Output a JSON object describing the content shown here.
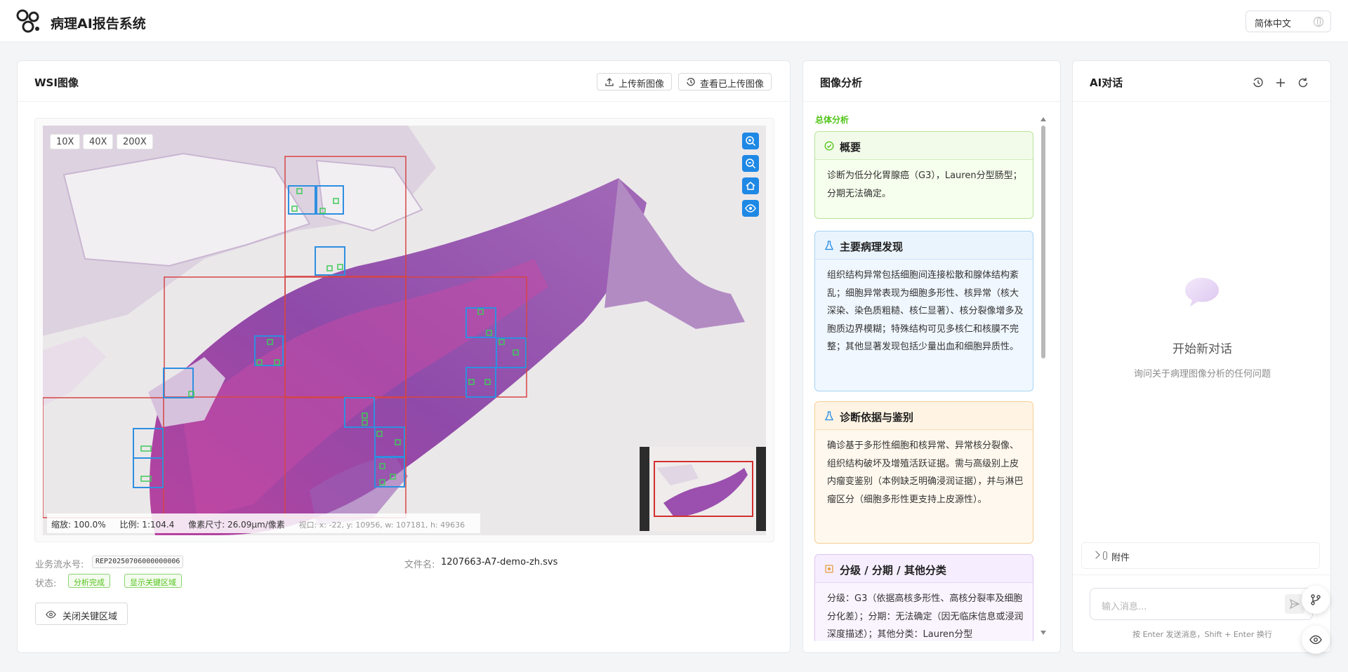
{
  "app": {
    "title": "病理AI报告系统",
    "language": "简体中文"
  },
  "wsi": {
    "title": "WSI图像",
    "upload_label": "上传新图像",
    "view_uploaded_label": "查看已上传图像",
    "zoom_levels": [
      "10X",
      "40X",
      "200X"
    ],
    "status": {
      "zoom": "缩放: 100.0%",
      "ratio": "比例: 1:104.4",
      "pixel_size": "像素尺寸: 26.09μm/像素",
      "viewport": "视口: x: -22, y: 10956, w: 107181, h: 49636"
    },
    "meta": {
      "serial_label": "业务流水号:",
      "serial_value": "REP20250706000000006",
      "file_label": "文件名:",
      "file_value": "1207663-A7-demo-zh.svs",
      "status_label": "状态:",
      "status_tag": "分析完成",
      "roi_tag": "显示关键区域",
      "close_roi_label": "关闭关键区域"
    },
    "colors": {
      "major_roi": "#d64545",
      "minor_roi": "#2e8fe0",
      "cell_mark": "#3fca5a",
      "tool_blue": "#1e88e5"
    }
  },
  "analysis": {
    "title": "图像分析",
    "section": "总体分析",
    "cards": [
      {
        "title": "概要",
        "body": "诊断为低分化胃腺癌（G3），Lauren分型肠型；分期无法确定。"
      },
      {
        "title": "主要病理发现",
        "body": "组织结构异常包括细胞间连接松散和腺体结构紊乱；细胞异常表现为细胞多形性、核异常（核大深染、染色质粗糙、核仁显著）、核分裂像增多及胞质边界模糊；特殊结构可见多核仁和核膜不完整；其他显著发现包括少量出血和细胞异质性。"
      },
      {
        "title": "诊断依据与鉴别",
        "body": "确诊基于多形性细胞和核异常、异常核分裂像、组织结构破坏及增殖活跃证据。需与高级别上皮内瘤变鉴别（本例缺乏明确浸润证据），并与淋巴瘤区分（细胞多形性更支持上皮源性）。"
      },
      {
        "title": "分级 / 分期 / 其他分类",
        "body": "分级：G3（依据高核多形性、高核分裂率及细胞分化差）；分期：无法确定（因无临床信息或浸润深度描述）；其他分类：Lauren分型"
      }
    ]
  },
  "ai": {
    "title": "AI对话",
    "empty_title": "开始新对话",
    "empty_sub": "询问关于病理图像分析的任何问题",
    "attach_label": "附件",
    "input_placeholder": "输入消息...",
    "hint": "按 Enter 发送消息，Shift + Enter 换行"
  }
}
